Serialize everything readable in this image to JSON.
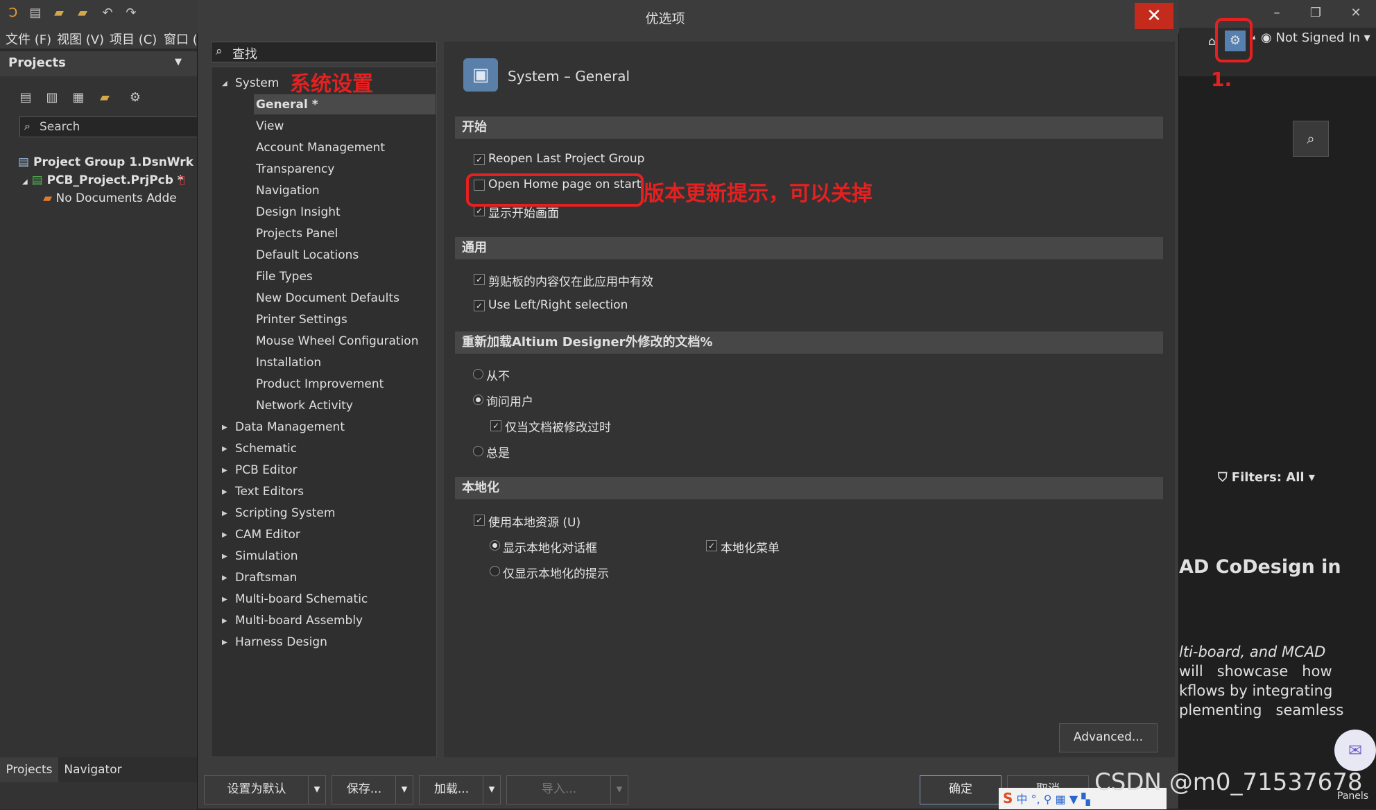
{
  "app": {
    "menu": [
      "文件 (F)",
      "视图 (V)",
      "项目 (C)",
      "窗口 ("
    ],
    "account": "Not Signed In"
  },
  "projects": {
    "title": "Projects",
    "search_placeholder": "Search",
    "tree": [
      "Project Group 1.DsnWrk",
      "PCB_Project.PrjPcb *",
      "No Documents Adde"
    ],
    "tabs": [
      "Projects",
      "Navigator"
    ]
  },
  "dialog": {
    "title": "优选项",
    "search_placeholder": "查找",
    "page_title": "System – General",
    "nav": {
      "system": "System",
      "system_children": [
        "General *",
        "View",
        "Account Management",
        "Transparency",
        "Navigation",
        "Design Insight",
        "Projects Panel",
        "Default Locations",
        "File Types",
        "New Document Defaults",
        "Printer Settings",
        "Mouse Wheel Configuration",
        "Installation",
        "Product Improvement",
        "Network Activity"
      ],
      "groups": [
        "Data Management",
        "Schematic",
        "PCB Editor",
        "Text Editors",
        "Scripting System",
        "CAM Editor",
        "Simulation",
        "Draftsman",
        "Multi-board Schematic",
        "Multi-board Assembly",
        "Harness Design"
      ]
    },
    "sections": {
      "start": {
        "header": "开始",
        "reopen": "Reopen Last Project Group",
        "home": "Open Home page on start",
        "splash": "显示开始画面"
      },
      "general": {
        "header": "通用",
        "clipboard": "剪贴板的内容仅在此应用中有效",
        "leftright": "Use Left/Right selection"
      },
      "reload": {
        "header": "重新加载Altium Designer外修改的文档%",
        "never": "从不",
        "ask": "询问用户",
        "only_modified": "仅当文档被修改过时",
        "always": "总是"
      },
      "localization": {
        "header": "本地化",
        "use_local": "使用本地资源 (U)",
        "show_dialogs": "显示本地化对话框",
        "local_menu": "本地化菜单",
        "hints_only": "仅显示本地化的提示"
      }
    },
    "advanced": "Advanced...",
    "buttons": {
      "set_default": "设置为默认",
      "save": "保存...",
      "load": "加载...",
      "import": "导入...",
      "ok": "确定",
      "cancel": "取消"
    }
  },
  "right_panel": {
    "filters": "Filters: All",
    "headline": "AD CoDesign in",
    "body": [
      "lti-board, and MCAD",
      "will   showcase   how",
      "kflows by integrating",
      "plementing   seamless"
    ],
    "panels": "Panels"
  },
  "annotations": {
    "system": "系统设置",
    "step": "1.",
    "home_note": "版本更新提示，可以关掉"
  },
  "watermark": "CSDN @m0_71537678"
}
